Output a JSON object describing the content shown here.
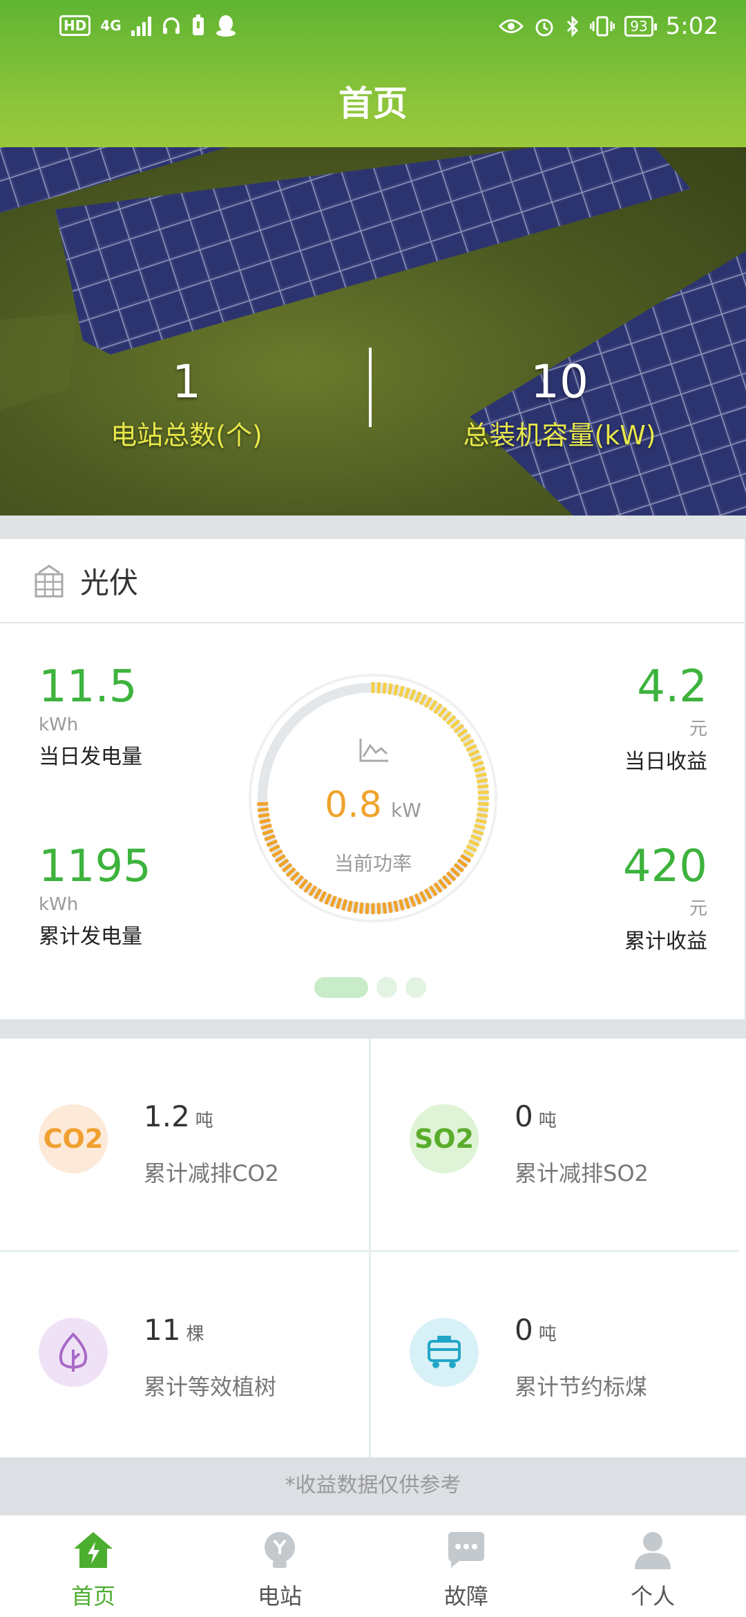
{
  "status_bar": {
    "hd": "HD",
    "network": "4G",
    "battery": "93",
    "time": "5:02"
  },
  "header": {
    "title": "首页"
  },
  "banner": {
    "stations": {
      "value": "1",
      "label": "电站总数(个)"
    },
    "capacity": {
      "value": "10",
      "label": "总装机容量(kW)"
    }
  },
  "pv": {
    "title": "光伏",
    "daily_generation": {
      "value": "11.5",
      "unit": "kWh",
      "label": "当日发电量"
    },
    "total_generation": {
      "value": "1195",
      "unit": "kWh",
      "label": "累计发电量"
    },
    "daily_income": {
      "value": "4.2",
      "unit": "元",
      "label": "当日收益"
    },
    "total_income": {
      "value": "420",
      "unit": "元",
      "label": "累计收益"
    },
    "current_power": {
      "value": "0.8",
      "unit": "kW",
      "label": "当前功率",
      "gauge_fraction": 0.75
    },
    "pager": {
      "count": 3,
      "active": 0
    }
  },
  "environment": {
    "co2": {
      "icon_text": "CO2",
      "value": "1.2",
      "unit": "吨",
      "label": "累计减排CO2"
    },
    "so2": {
      "icon_text": "SO2",
      "value": "0",
      "unit": "吨",
      "label": "累计减排SO2"
    },
    "trees": {
      "icon": "leaf-icon",
      "value": "11",
      "unit": "棵",
      "label": "累计等效植树"
    },
    "coal": {
      "icon": "coal-cart-icon",
      "value": "0",
      "unit": "吨",
      "label": "累计节约标煤"
    }
  },
  "notice": "*收益数据仅供参考",
  "nav": [
    {
      "label": "首页",
      "icon": "home-icon",
      "active": true
    },
    {
      "label": "电站",
      "icon": "station-icon",
      "active": false
    },
    {
      "label": "故障",
      "icon": "fault-icon",
      "active": false
    },
    {
      "label": "个人",
      "icon": "person-icon",
      "active": false
    }
  ],
  "colors": {
    "accent": "#3db33d",
    "gauge_orange": "#f0a32a",
    "gauge_yellow": "#f5cf4a",
    "label_yellow": "#e8e84a"
  }
}
